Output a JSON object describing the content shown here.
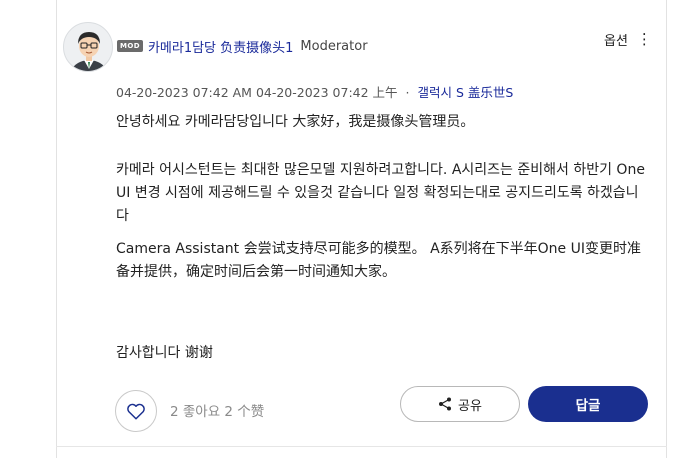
{
  "post": {
    "author": {
      "badge": "MOD",
      "name": "카메라1담당 负责摄像头1",
      "role": "Moderator"
    },
    "options_label": "옵션",
    "meta": {
      "created": "04-20-2023 07:42 AM",
      "edited": "04-20-2023 07:42 上午",
      "separator": "·",
      "device": "갤럭시 S",
      "device_cn": "盖乐世S"
    },
    "body": {
      "p1": "안녕하세요 카메라담당입니다 大家好，我是摄像头管理员。",
      "p2": "카메라 어시스턴트는 최대한 많은모델 지원하려고합니다. A시리즈는 준비해서 하반기 One UI 변경 시점에 제공해드릴 수 있을것 같습니다 일정 확정되는대로 공지드리도록 하겠습니다",
      "p3": "Camera Assistant 会尝试支持尽可能多的模型。 A系列将在下半年One UI变更时准备并提供，确定时间后会第一时间通知大家。",
      "p4": "감사합니다 谢谢"
    },
    "actions": {
      "like_count": "2 좋아요 2 个赞",
      "share_label": "공유",
      "reply_label": "답글"
    }
  }
}
